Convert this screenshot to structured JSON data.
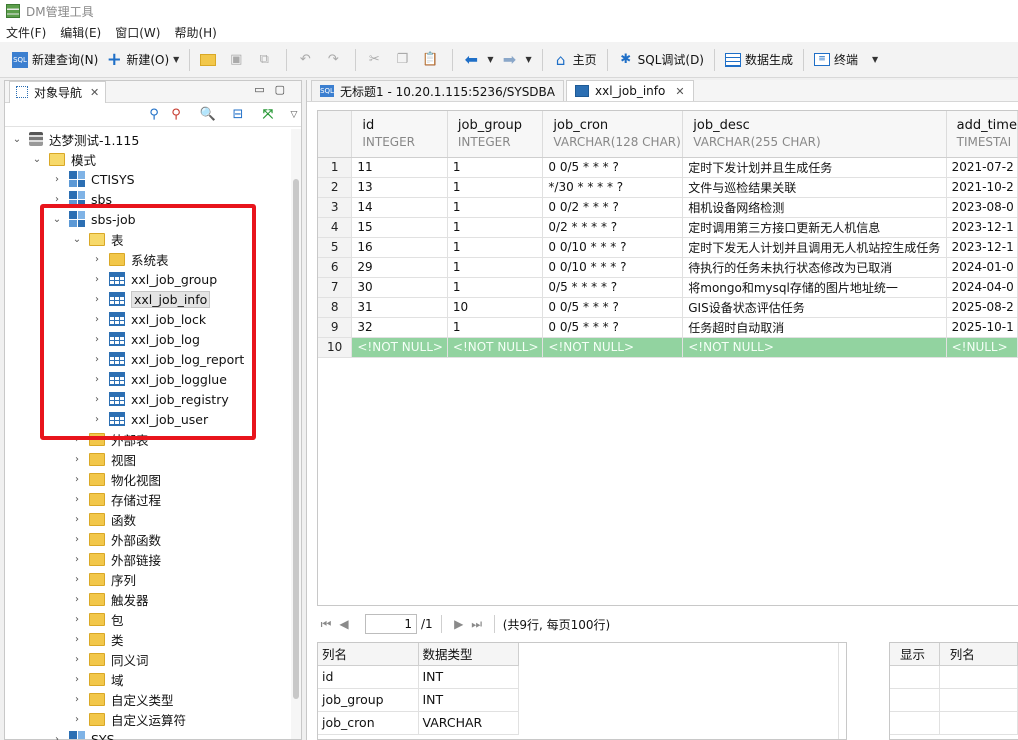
{
  "app": {
    "title": "DM管理工具"
  },
  "menu": [
    "文件(F)",
    "编辑(E)",
    "窗口(W)",
    "帮助(H)"
  ],
  "toolbar": {
    "new_query": "新建查询(N)",
    "new": "新建(O)",
    "home": "主页",
    "sql_debug": "SQL调试(D)",
    "data_gen": "数据生成",
    "terminal": "终端"
  },
  "navigator": {
    "tab_label": "对象导航",
    "tree": {
      "root": "达梦测试-1.115",
      "schema_folder": "模式",
      "schemas": [
        "CTISYS",
        "sbs",
        "sbs-job"
      ],
      "tables_folder": "表",
      "system_tables": "系统表",
      "tables": [
        "xxl_job_group",
        "xxl_job_info",
        "xxl_job_lock",
        "xxl_job_log",
        "xxl_job_log_report",
        "xxl_job_logglue",
        "xxl_job_registry",
        "xxl_job_user"
      ],
      "folders": [
        "外部表",
        "视图",
        "物化视图",
        "存储过程",
        "函数",
        "外部函数",
        "外部链接",
        "序列",
        "触发器",
        "包",
        "类",
        "同义词",
        "域",
        "自定义类型",
        "自定义运算符"
      ],
      "next_schema": "SYS"
    }
  },
  "editor": {
    "tabs": [
      {
        "label": "无标题1 - 10.20.1.115:5236/SYSDBA"
      },
      {
        "label": "xxl_job_info"
      }
    ]
  },
  "grid": {
    "columns": [
      {
        "name": "id",
        "type": "INTEGER"
      },
      {
        "name": "job_group",
        "type": "INTEGER"
      },
      {
        "name": "job_cron",
        "type": "VARCHAR(128 CHAR)"
      },
      {
        "name": "job_desc",
        "type": "VARCHAR(255 CHAR)"
      },
      {
        "name": "add_time",
        "type": "TIMESTAI"
      }
    ],
    "rows": [
      {
        "rn": "1",
        "cells": [
          "11",
          "1",
          "0 0/5 * * * ?",
          "定时下发计划并且生成任务",
          "2021-07-2"
        ]
      },
      {
        "rn": "2",
        "cells": [
          "13",
          "1",
          "*/30 * * * * ?",
          "文件与巡检结果关联",
          "2021-10-2"
        ]
      },
      {
        "rn": "3",
        "cells": [
          "14",
          "1",
          "0 0/2  * * * ?",
          "相机设备网络检测",
          "2023-08-0"
        ]
      },
      {
        "rn": "4",
        "cells": [
          "15",
          "1",
          "0/2 * * * * ?",
          "定时调用第三方接口更新无人机信息",
          "2023-12-1"
        ]
      },
      {
        "rn": "5",
        "cells": [
          "16",
          "1",
          "0 0/10 * * * ?",
          "定时下发无人计划并且调用无人机站控生成任务",
          "2023-12-1"
        ]
      },
      {
        "rn": "6",
        "cells": [
          "29",
          "1",
          "0 0/10 * * * ?",
          "待执行的任务未执行状态修改为已取消",
          "2024-01-0"
        ]
      },
      {
        "rn": "7",
        "cells": [
          "30",
          "1",
          "0/5 * * * * ?",
          "将mongo和mysql存储的图片地址统一",
          "2024-04-0"
        ]
      },
      {
        "rn": "8",
        "cells": [
          "31",
          "10",
          "0 0/5 * * * ?",
          "GIS设备状态评估任务",
          "2025-08-2"
        ]
      },
      {
        "rn": "9",
        "cells": [
          "32",
          "1",
          "0 0/5 * * * ?",
          "任务超时自动取消",
          "2025-10-1"
        ]
      }
    ],
    "new_row": {
      "rn": "10",
      "cells": [
        "<!NOT NULL>",
        "<!NOT NULL>",
        "<!NOT NULL>",
        "<!NOT NULL>",
        "<!NULL>"
      ]
    }
  },
  "pager": {
    "page": "1",
    "total": "/1",
    "summary": "(共9行, 每页100行)"
  },
  "columns_panel": {
    "headers": [
      "列名",
      "数据类型"
    ],
    "rows": [
      [
        "id",
        "INT"
      ],
      [
        "job_group",
        "INT"
      ],
      [
        "job_cron",
        "VARCHAR"
      ]
    ]
  },
  "display_panel": {
    "headers": [
      "显示",
      "列名"
    ]
  }
}
